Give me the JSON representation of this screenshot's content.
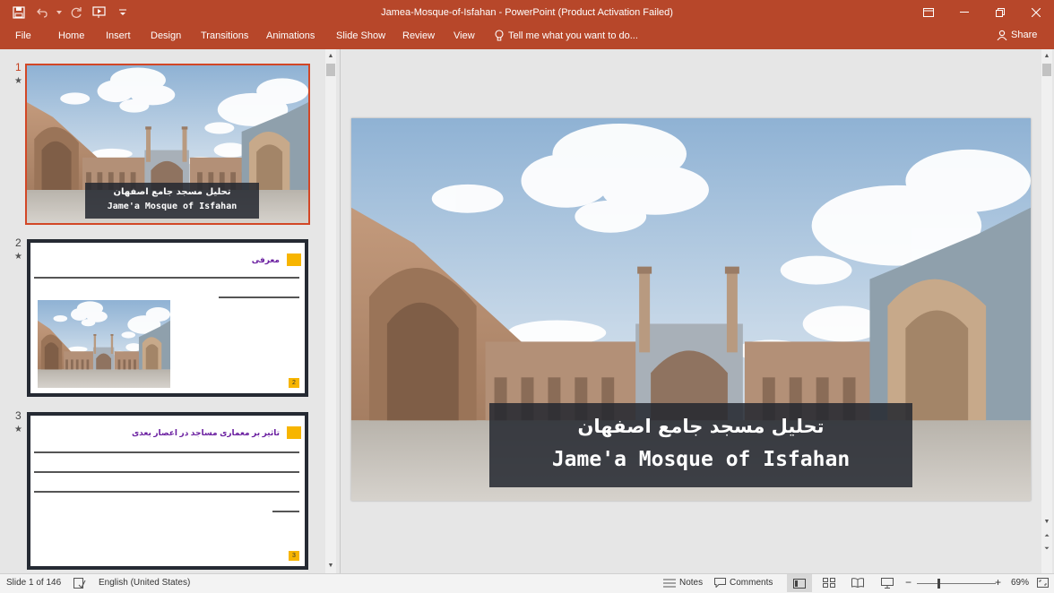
{
  "window": {
    "title": "Jamea-Mosque-of-Isfahan - PowerPoint (Product Activation Failed)"
  },
  "ribbon": {
    "tabs": [
      "File",
      "Home",
      "Insert",
      "Design",
      "Transitions",
      "Animations",
      "Slide Show",
      "Review",
      "View"
    ],
    "tell_me": "Tell me what you want to do...",
    "share": "Share"
  },
  "thumbnails": [
    {
      "number": "1",
      "title_fa": "تحلیل مسجد جامع اصفهان",
      "title_en": "Jame'a Mosque of Isfahan"
    },
    {
      "number": "2",
      "title_fa": "معرفی",
      "page": "2"
    },
    {
      "number": "3",
      "title_fa": "تاثیر بر معماری مساجد در اعصار بعدی",
      "page": "3"
    }
  ],
  "slide": {
    "title_fa": "تحلیل مسجد جامع اصفهان",
    "title_en": "Jame'a Mosque of Isfahan"
  },
  "status": {
    "slide_info": "Slide 1 of 146",
    "language": "English (United States)",
    "notes": "Notes",
    "comments": "Comments",
    "zoom": "69%"
  },
  "colors": {
    "accent": "#b7472a",
    "selected_border": "#d24726",
    "thumb_frame": "#252a33",
    "title_purple": "#6a1fa0",
    "highlight_yellow": "#f7b500"
  }
}
